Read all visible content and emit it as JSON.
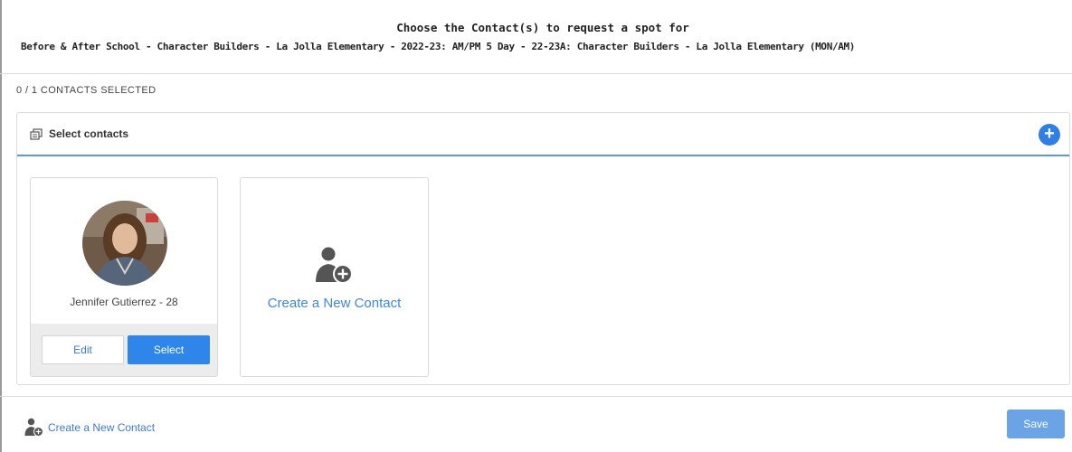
{
  "header": {
    "title": "Choose the Contact(s) to request a spot for",
    "subtitle": "Before & After School - Character Builders - La Jolla Elementary - 2022-23: AM/PM 5 Day - 22-23A: Character Builders - La Jolla Elementary (MON/AM)"
  },
  "selection": {
    "counter": "0 / 1 CONTACTS SELECTED"
  },
  "panel": {
    "title": "Select contacts",
    "title_icon": "stack-icon",
    "add_icon": "plus-circle-icon",
    "add_symbol": "+"
  },
  "contacts": [
    {
      "name": "Jennifer Gutierrez - 28",
      "edit_label": "Edit",
      "select_label": "Select"
    }
  ],
  "new_contact_card": {
    "label": "Create a New Contact",
    "icon": "add-person-icon"
  },
  "footer": {
    "create_label": "Create a New Contact",
    "create_icon": "add-person-icon",
    "save_label": "Save"
  },
  "colors": {
    "accent": "#2f86ea",
    "link": "#3a7bd5",
    "divider": "#5b9bd5",
    "save_disabled": "#6aa4e6"
  }
}
